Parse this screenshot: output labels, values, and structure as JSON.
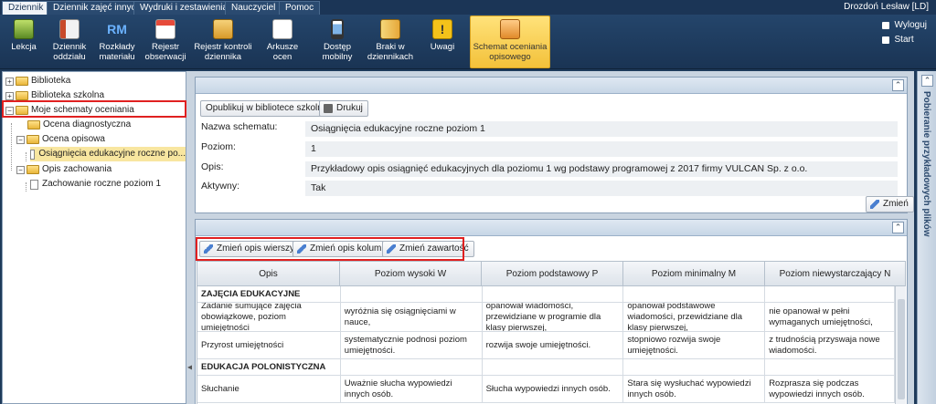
{
  "menu": {
    "tabs": [
      "Dziennik",
      "Dziennik zajęć innych",
      "Wydruki i zestawienia",
      "Nauczyciel",
      "Pomoc"
    ],
    "active_tab": "Dziennik",
    "user": "Drozdoń Lesław [LD]"
  },
  "ribbon": {
    "items": [
      {
        "label": "Lekcja",
        "icon": "lesson-icon"
      },
      {
        "label": "Dziennik oddziału",
        "icon": "class-journal-icon"
      },
      {
        "label": "Rozkłady materiału",
        "icon": "rm-icon"
      },
      {
        "label": "Rejestr obserwacji",
        "icon": "observation-register-icon"
      },
      {
        "label": "Rejestr kontroli dziennika",
        "icon": "journal-control-icon"
      },
      {
        "label": "Arkusze ocen",
        "icon": "grade-sheets-icon"
      },
      {
        "label": "Dostęp mobilny",
        "icon": "mobile-access-icon"
      },
      {
        "label": "Braki w dziennikach",
        "icon": "journal-gaps-icon"
      },
      {
        "label": "Uwagi",
        "icon": "warning-icon"
      },
      {
        "label": "Schemat oceniania opisowego",
        "icon": "descriptive-scheme-icon"
      }
    ],
    "right": {
      "logout": "Wyloguj",
      "start": "Start"
    }
  },
  "tree": {
    "items": [
      {
        "label": "Biblioteka",
        "level": 0
      },
      {
        "label": "Biblioteka szkolna",
        "level": 0
      },
      {
        "label": "Moje schematy oceniania",
        "level": 0
      },
      {
        "label": "Ocena diagnostyczna",
        "level": 1
      },
      {
        "label": "Ocena opisowa",
        "level": 1
      },
      {
        "label": "Osiągnięcia edukacyjne roczne po...",
        "level": 2
      },
      {
        "label": "Opis zachowania",
        "level": 1
      },
      {
        "label": "Zachowanie roczne poziom 1",
        "level": 2
      }
    ]
  },
  "details": {
    "publish_button": "Opublikuj w bibliotece szkolnej",
    "print_button": "Drukuj",
    "fields": [
      {
        "label": "Nazwa schematu:",
        "value": "Osiągnięcia edukacyjne roczne poziom 1"
      },
      {
        "label": "Poziom:",
        "value": "1"
      },
      {
        "label": "Opis:",
        "value": "Przykładowy opis osiągnięć edukacyjnych dla poziomu 1 wg podstawy programowej z 2017 firmy VULCAN Sp. z o.o."
      },
      {
        "label": "Aktywny:",
        "value": "Tak"
      }
    ],
    "edit_button": "Zmień"
  },
  "grid": {
    "toolbar": [
      "Zmień opis wierszy",
      "Zmień opis kolumn",
      "Zmień zawartość"
    ],
    "headers": [
      "Opis",
      "Poziom wysoki W",
      "Poziom podstawowy P",
      "Poziom minimalny M",
      "Poziom niewystarczający N"
    ],
    "rows": [
      {
        "section": true,
        "cells": [
          "ZAJĘCIA EDUKACYJNE",
          "",
          "",
          "",
          ""
        ]
      },
      {
        "section": false,
        "cells": [
          "Zadanie sumujące zajęcia obowiązkowe, poziom umiejętności",
          "wyróżnia się osiągnięciami w nauce,",
          "opanował wiadomości, przewidziane w programie dla klasy pierwszej,",
          "opanował podstawowe wiadomości, przewidziane dla klasy pierwszej,",
          "nie opanował w pełni wymaganych umiejętności,"
        ]
      },
      {
        "section": false,
        "cells": [
          "Przyrost umiejętności",
          "systematycznie podnosi poziom umiejętności.",
          "rozwija swoje umiejętności.",
          "stopniowo rozwija swoje umiejętności.",
          "z trudnością przyswaja nowe wiadomości."
        ]
      },
      {
        "section": true,
        "cells": [
          "EDUKACJA POLONISTYCZNA",
          "",
          "",
          "",
          ""
        ]
      },
      {
        "section": false,
        "cells": [
          "Słuchanie",
          "Uważnie słucha wypowiedzi innych osób.",
          "Słucha wypowiedzi innych osób.",
          "Stara się wysłuchać wypowiedzi innych osób.",
          "Rozprasza się podczas wypowiedzi innych osób."
        ]
      }
    ]
  },
  "side_tab": "Pobieranie przykładowych plików"
}
